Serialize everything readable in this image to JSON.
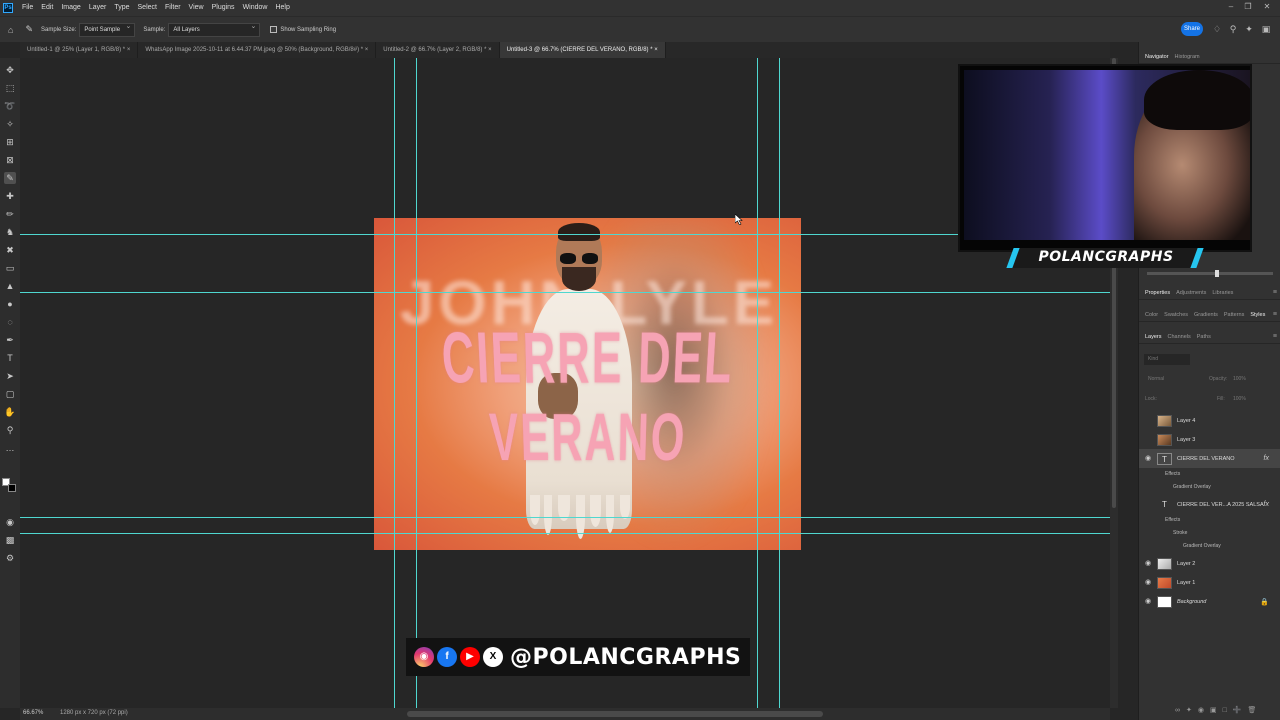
{
  "app": {
    "menu": [
      "File",
      "Edit",
      "Image",
      "Layer",
      "Type",
      "Select",
      "Filter",
      "View",
      "Plugins",
      "Window",
      "Help"
    ],
    "logo": "Ps"
  },
  "options": {
    "sample_size_label": "Sample Size:",
    "sample_size_value": "Point Sample",
    "sample_label": "Sample:",
    "sample_value": "All Layers",
    "show_ring_label": "Show Sampling Ring",
    "share_label": "Share"
  },
  "tabs": [
    "Untitled-1 @ 25% (Layer 1, RGB/8) *",
    "WhatsApp Image 2025-10-11 at 6.44.37 PM.jpeg @ 50% (Background, RGB/8#) *",
    "Untitled-2 @ 66.7% (Layer 2, RGB/8) *",
    "Untitled-3 @ 66.7% (CIERRE  DEL VERANO, RGB/8) *"
  ],
  "artwork": {
    "bg_text": "JOHN  LYLE",
    "title_text": "CIERRE DEL VERANO"
  },
  "social": {
    "icons": [
      "instagram-icon",
      "facebook-icon",
      "youtube-icon",
      "x-icon"
    ],
    "handle": "@POLANCGRAPHS"
  },
  "webcam": {
    "nameplate": "POLANCGRAPHS"
  },
  "status": {
    "zoom": "66.67%",
    "doc": "1280 px x 720 px (72 ppi)"
  },
  "panel": {
    "nav_tabs": [
      "Navigator",
      "Histogram"
    ],
    "prop_tabs": [
      "Properties",
      "Adjustments",
      "Libraries"
    ],
    "color_tabs": [
      "Color",
      "Swatches",
      "Gradients",
      "Patterns",
      "Styles"
    ],
    "layer_tabs": [
      "Layers",
      "Channels",
      "Paths"
    ],
    "search_placeholder": "Kind",
    "blend_mode": "Normal",
    "opacity_label": "Opacity:",
    "opacity_value": "100%",
    "lock_label": "Lock:",
    "fill_label": "Fill:",
    "fill_value": "100%"
  },
  "layers": [
    {
      "name": "Layer 4",
      "visible": false
    },
    {
      "name": "Layer 3",
      "visible": false
    },
    {
      "name": "CIERRE  DEL VERANO",
      "visible": true,
      "selected": true,
      "type": "text",
      "fx": "fx",
      "effects_label": "Effects",
      "effects": [
        "Gradient Overlay"
      ]
    },
    {
      "name": "CIERRE  DEL VER...A 2025 SALSA",
      "visible": false,
      "type": "text",
      "fx": "fx",
      "effects_label": "Effects",
      "effects": [
        "Stroke",
        "Gradient Overlay"
      ]
    },
    {
      "name": "Layer 2",
      "visible": true
    },
    {
      "name": "Layer 1",
      "visible": true
    },
    {
      "name": "Background",
      "visible": true,
      "locked": true
    }
  ]
}
